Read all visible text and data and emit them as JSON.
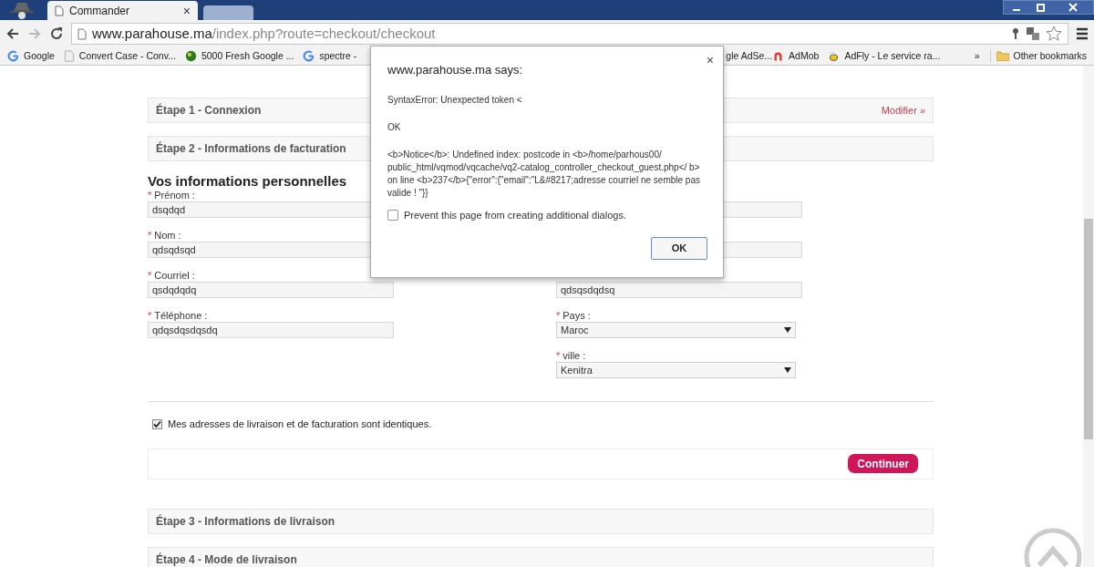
{
  "browser": {
    "tabs": [
      {
        "title": "Commander",
        "close": "×",
        "selected": true
      },
      {
        "selected": false
      }
    ],
    "address": {
      "host": "www.parahouse.ma",
      "path": "/index.php?route=checkout/checkout"
    },
    "bookmarks": [
      {
        "label": "Google",
        "kind": "g"
      },
      {
        "label": "Convert Case - Conv...",
        "kind": "page"
      },
      {
        "label": "5000 Fresh Google ...",
        "kind": "globe"
      },
      {
        "label": "spectre -",
        "kind": "g"
      },
      {
        "label": "gle AdSe...",
        "kind": "none"
      },
      {
        "label": "AdMob",
        "kind": "admob"
      },
      {
        "label": "AdFly - Le service ra...",
        "kind": "bee"
      }
    ],
    "overflow": "»",
    "other_bookmarks": "Other bookmarks"
  },
  "checkout": {
    "steps_before": [
      {
        "title": "Étape 1 - Connexion",
        "action": "Modifier »"
      },
      {
        "title": "Étape 2 - Informations de facturation"
      }
    ],
    "section_title": "Vos informations personnelles",
    "required_mark": "*",
    "left_fields": [
      {
        "label": "Prénom :",
        "value": "dsqdqd",
        "required": true
      },
      {
        "label": "Nom :",
        "value": "qdsqdsqd",
        "required": true
      },
      {
        "label": "Courriel :",
        "value": "qsdqdqdq",
        "required": true
      },
      {
        "label": "Téléphone :",
        "value": "qdqsdqsdqsdq",
        "required": true
      }
    ],
    "right_fields": [
      {
        "kind": "text"
      },
      {
        "kind": "text"
      },
      {
        "kind": "text",
        "value": "qdsqsdqdsq"
      },
      {
        "kind": "select",
        "label": "Pays :",
        "value": "Maroc",
        "required": true
      },
      {
        "kind": "select",
        "label": "ville :",
        "value": "Kenitra",
        "required": true
      }
    ],
    "same_address": {
      "label": "Mes adresses de livraison et de facturation sont identiques.",
      "checked": true
    },
    "continue_button": "Continuer",
    "steps_after": [
      {
        "title": "Étape 3 - Informations de livraison"
      },
      {
        "title": "Étape 4 - Mode de livraison"
      }
    ]
  },
  "dialog": {
    "title": "www.parahouse.ma says:",
    "close": "×",
    "lines": [
      "SyntaxError: Unexpected token <",
      "OK",
      "<b>Notice</b>: Undefined index: postcode in <b>/home/parhous00/ public_html/vqmod/vqcache/vq2-catalog_controller_checkout_guest.php</ b> on line <b>237</b>{\"error\":{\"email\":\"L&#8217;adresse courriel ne semble pas valide ! \"}}"
    ],
    "prevent": {
      "label": "Prevent this page from creating additional dialogs.",
      "checked": false
    },
    "ok": "OK"
  }
}
